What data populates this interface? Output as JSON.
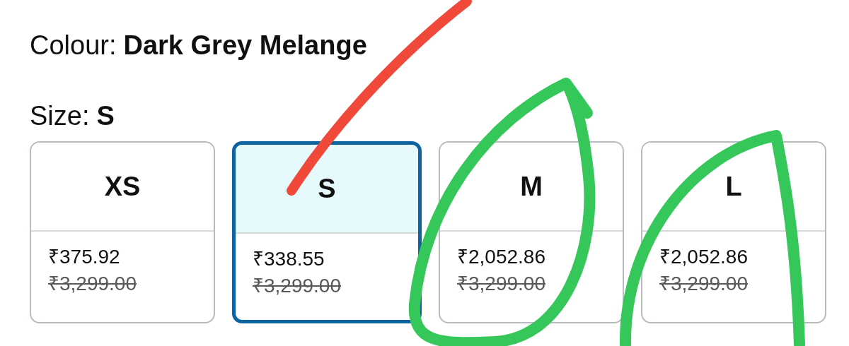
{
  "colour": {
    "label": "Colour:",
    "value": "Dark Grey Melange"
  },
  "size": {
    "label": "Size:",
    "value": "S"
  },
  "sizes": [
    {
      "label": "XS",
      "price": "₹375.92",
      "list_price": "₹3,299.00",
      "selected": false
    },
    {
      "label": "S",
      "price": "₹338.55",
      "list_price": "₹3,299.00",
      "selected": true
    },
    {
      "label": "M",
      "price": "₹2,052.86",
      "list_price": "₹3,299.00",
      "selected": false
    },
    {
      "label": "L",
      "price": "₹2,052.86",
      "list_price": "₹3,299.00",
      "selected": false
    }
  ]
}
